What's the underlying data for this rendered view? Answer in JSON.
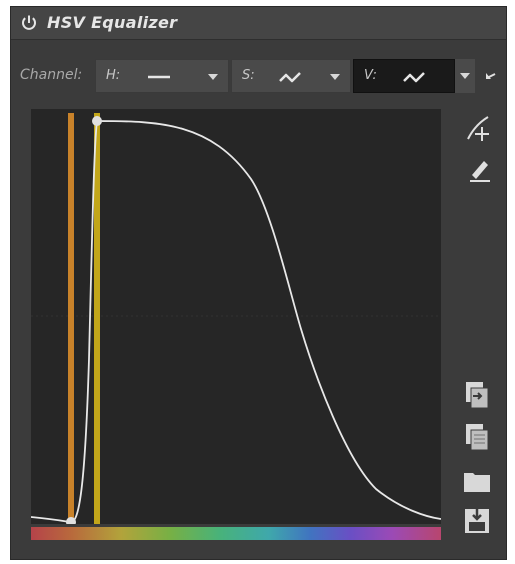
{
  "title": "HSV Equalizer",
  "icons": {
    "power": "power-icon",
    "reset": "reset-arrow-icon",
    "pick_curve": "curve-picker-icon",
    "pick_color": "color-picker-icon",
    "copy_to": "copy-to-icon",
    "paste": "paste-icon",
    "open": "folder-icon",
    "save": "save-icon"
  },
  "channels": {
    "label": "Channel:",
    "h": {
      "label": "H:",
      "curve": "linear"
    },
    "s": {
      "label": "S:",
      "curve": "curve"
    },
    "v": {
      "label": "V:",
      "curve": "curve",
      "active": true
    }
  },
  "colors": {
    "panel_bg": "#3b3b3b",
    "graph_bg": "#262626",
    "curve": "#e8e8e8",
    "marker_orange": "#c8822a",
    "marker_yellow": "#c2a61a"
  }
}
